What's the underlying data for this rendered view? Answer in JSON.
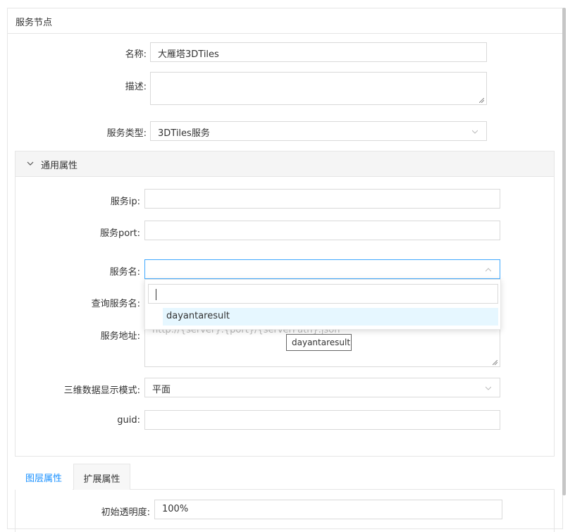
{
  "panel": {
    "title": "服务节点"
  },
  "form": {
    "name_label": "名称:",
    "name_value": "大雁塔3DTiles",
    "desc_label": "描述:",
    "desc_value": "",
    "type_label": "服务类型:",
    "type_value": "3DTiles服务"
  },
  "common": {
    "title": "通用属性",
    "ip_label": "服务ip:",
    "port_label": "服务port:",
    "service_name_label": "服务名:",
    "query_name_label": "查询服务名:",
    "address_label": "服务地址:",
    "address_placeholder": "http://{server}:{port}/{serverPath}.json",
    "display_mode_label": "三维数据显示模式:",
    "display_mode_value": "平面",
    "guid_label": "guid:"
  },
  "dropdown": {
    "search_value": "",
    "options": [
      "dayantaresult"
    ],
    "tooltip": "dayantaresult"
  },
  "tabs": {
    "items": [
      "图层属性",
      "扩展属性"
    ],
    "active": 0
  },
  "layer": {
    "opacity_label": "初始透明度:",
    "opacity_value": "100%"
  },
  "colors": {
    "accent": "#1890ff",
    "option_highlight": "#e6f7ff",
    "border": "#d9d9d9"
  }
}
